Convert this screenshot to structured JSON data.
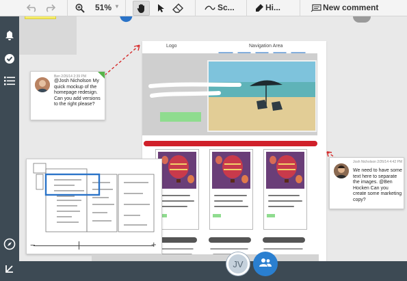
{
  "toolbar": {
    "zoom_value": "51%",
    "screenshot_label": "Sc...",
    "highlight_label": "Hi...",
    "new_comment_label": "New comment"
  },
  "mockup": {
    "logo_label": "Logo",
    "nav_label": "Navigation Area"
  },
  "comments": [
    {
      "meta": "Ben 2/26/14 2:39 PM",
      "text": "@Josh Nicholson My quick mockup of the homepage redesign. Can you add versions to the right please?"
    },
    {
      "meta": "Josh Nicholson 2/26/14 4:42 PM",
      "text": "We need to have some text here to separate the images. @Ben Hocken Can you create some marketing copy?"
    }
  ],
  "collaborators": {
    "initials": "JV"
  },
  "colors": {
    "rail": "#3d4a54",
    "accent_blue": "#2a7fd0",
    "heading_red": "#d0202a",
    "comment_arrow_red": "#d62a2a"
  }
}
